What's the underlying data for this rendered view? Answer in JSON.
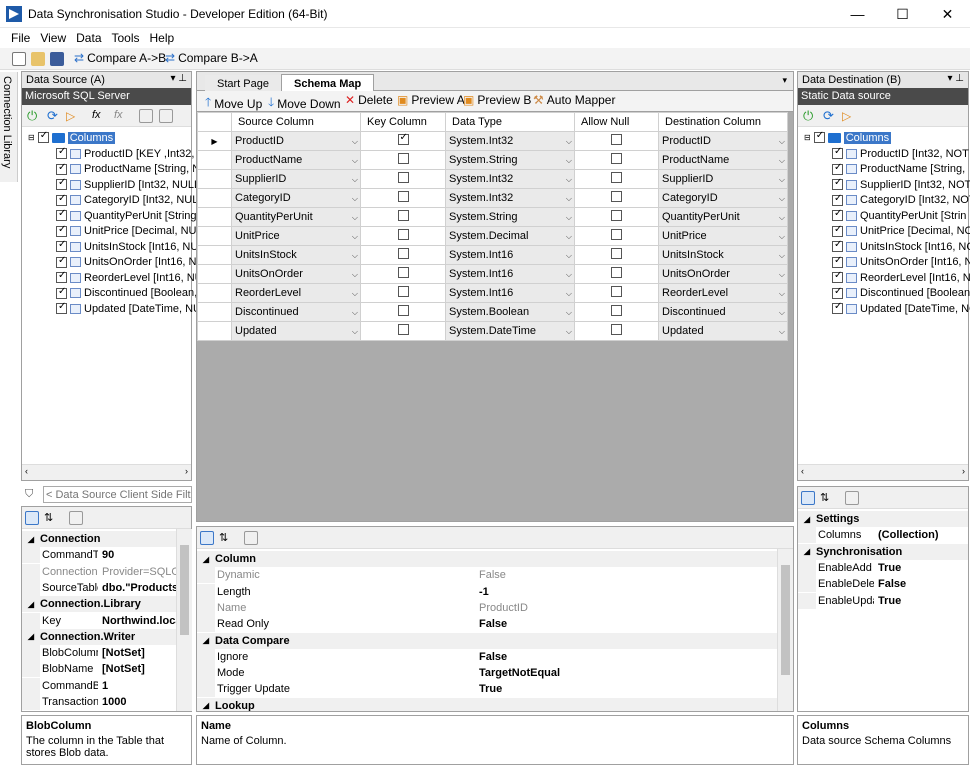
{
  "window": {
    "title": "Data Synchronisation Studio - Developer Edition (64-Bit)",
    "min": "—",
    "max": "☐",
    "close": "✕"
  },
  "menu": [
    "File",
    "View",
    "Data",
    "Tools",
    "Help"
  ],
  "toolbar": {
    "compare_ab": "Compare A->B",
    "compare_ba": "Compare B->A"
  },
  "side_tab": "Connection Library",
  "left": {
    "header": "Data Source (A)",
    "subheader": "Microsoft SQL Server",
    "tree_root": "Columns",
    "tree_items": [
      "ProductID [KEY ,Int32, N",
      "ProductName [String, N",
      "SupplierID [Int32, NULL",
      "CategoryID [Int32, NUL",
      "QuantityPerUnit [String",
      "UnitPrice [Decimal, NU",
      "UnitsInStock [Int16, NU",
      "UnitsOnOrder [Int16, N",
      "ReorderLevel [Int16, NU",
      "Discontinued [Boolean,",
      "Updated [DateTime, NU"
    ],
    "filter_placeholder": "< Data Source Client Side Filter E",
    "props": [
      {
        "cat": true,
        "name": "Connection"
      },
      {
        "name": "CommandT",
        "value": "90",
        "bold": true
      },
      {
        "name": "Connection!",
        "value": "Provider=SQLOL",
        "gray": true
      },
      {
        "name": "SourceTable",
        "value": "dbo.\"Products\"",
        "bold": true
      },
      {
        "cat": true,
        "name": "Connection.Library"
      },
      {
        "name": "Key",
        "value": "Northwind.loca",
        "bold": true
      },
      {
        "cat": true,
        "name": "Connection.Writer"
      },
      {
        "name": "BlobColumn",
        "value": "[NotSet]",
        "bold": true
      },
      {
        "name": "BlobName",
        "value": "[NotSet]",
        "bold": true
      },
      {
        "name": "CommandB",
        "value": "1",
        "bold": true
      },
      {
        "name": "Transaction",
        "value": "1000",
        "bold": true
      }
    ],
    "info_title": "BlobColumn",
    "info_text": "The column in the Table that stores Blob data."
  },
  "center": {
    "tabs": [
      "Start Page",
      "Schema Map"
    ],
    "toolbar": [
      "Move Up",
      "Move Down",
      "Delete",
      "Preview A",
      "Preview B",
      "Auto Mapper"
    ],
    "columns": [
      "Source Column",
      "Key Column",
      "Data Type",
      "Allow Null",
      "Destination Column"
    ],
    "rows": [
      {
        "src": "ProductID",
        "key": true,
        "type": "System.Int32",
        "dst": "ProductID"
      },
      {
        "src": "ProductName",
        "key": false,
        "type": "System.String",
        "dst": "ProductName"
      },
      {
        "src": "SupplierID",
        "key": false,
        "type": "System.Int32",
        "dst": "SupplierID"
      },
      {
        "src": "CategoryID",
        "key": false,
        "type": "System.Int32",
        "dst": "CategoryID"
      },
      {
        "src": "QuantityPerUnit",
        "key": false,
        "type": "System.String",
        "dst": "QuantityPerUnit"
      },
      {
        "src": "UnitPrice",
        "key": false,
        "type": "System.Decimal",
        "dst": "UnitPrice"
      },
      {
        "src": "UnitsInStock",
        "key": false,
        "type": "System.Int16",
        "dst": "UnitsInStock"
      },
      {
        "src": "UnitsOnOrder",
        "key": false,
        "type": "System.Int16",
        "dst": "UnitsOnOrder"
      },
      {
        "src": "ReorderLevel",
        "key": false,
        "type": "System.Int16",
        "dst": "ReorderLevel"
      },
      {
        "src": "Discontinued",
        "key": false,
        "type": "System.Boolean",
        "dst": "Discontinued"
      },
      {
        "src": "Updated",
        "key": false,
        "type": "System.DateTime",
        "dst": "Updated"
      }
    ],
    "props": [
      {
        "cat": true,
        "name": "Column"
      },
      {
        "name": "Dynamic",
        "value": "False",
        "gray": true
      },
      {
        "name": "Length",
        "value": "-1",
        "bold": true
      },
      {
        "name": "Name",
        "value": "ProductID",
        "gray": true
      },
      {
        "name": "Read Only",
        "value": "False",
        "bold": true
      },
      {
        "cat": true,
        "name": "Data Compare"
      },
      {
        "name": "Ignore",
        "value": "False",
        "bold": true
      },
      {
        "name": "Mode",
        "value": "TargetNotEqual",
        "bold": true
      },
      {
        "name": "Trigger Update",
        "value": "True",
        "bold": true
      },
      {
        "cat": true,
        "name": "Lookup"
      }
    ],
    "info_title": "Name",
    "info_text": "Name of Column."
  },
  "right": {
    "header": "Data Destination (B)",
    "subheader": "Static Data source",
    "tree_root": "Columns",
    "tree_items": [
      "ProductID [Int32, NOT",
      "ProductName [String,",
      "SupplierID [Int32, NOT",
      "CategoryID [Int32, NOT",
      "QuantityPerUnit [Strin",
      "UnitPrice [Decimal, NC",
      "UnitsInStock [Int16, NC",
      "UnitsOnOrder [Int16, N",
      "ReorderLevel [Int16, NC",
      "Discontinued [Boolean,",
      "Updated [DateTime, NC"
    ],
    "props": [
      {
        "cat": true,
        "name": "Settings"
      },
      {
        "name": "Columns",
        "value": "(Collection)",
        "bold": true
      },
      {
        "cat": true,
        "name": "Synchronisation"
      },
      {
        "name": "EnableAdd",
        "value": "True",
        "bold": true
      },
      {
        "name": "EnableDelete",
        "value": "False",
        "bold": true
      },
      {
        "name": "EnableUpdat",
        "value": "True",
        "bold": true
      }
    ],
    "info_title": "Columns",
    "info_text": "Data source Schema Columns"
  }
}
